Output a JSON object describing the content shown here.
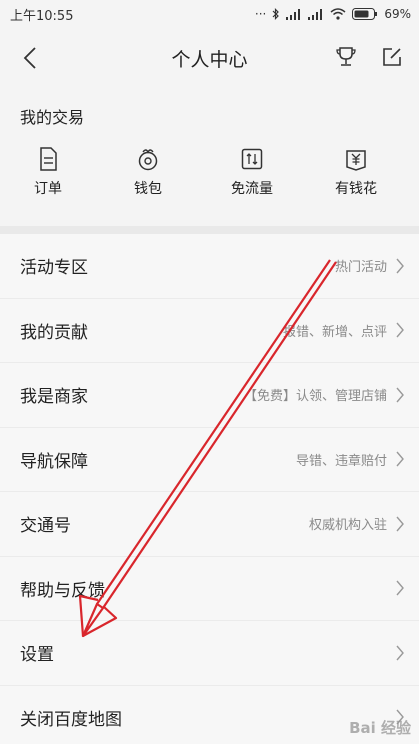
{
  "status": {
    "time": "上午10:55",
    "dots": "···",
    "battery_text": "69%"
  },
  "header": {
    "title": "个人中心"
  },
  "trade": {
    "title": "我的交易",
    "items": [
      {
        "label": "订单",
        "icon": "order-icon"
      },
      {
        "label": "钱包",
        "icon": "wallet-icon"
      },
      {
        "label": "免流量",
        "icon": "free-data-icon"
      },
      {
        "label": "有钱花",
        "icon": "loan-icon"
      }
    ]
  },
  "menu": [
    {
      "label": "活动专区",
      "sub": "热门活动"
    },
    {
      "label": "我的贡献",
      "sub": "报错、新增、点评"
    },
    {
      "label": "我是商家",
      "sub": "【免费】认领、管理店铺"
    },
    {
      "label": "导航保障",
      "sub": "导错、违章赔付"
    },
    {
      "label": "交通号",
      "sub": "权威机构入驻"
    },
    {
      "label": "帮助与反馈",
      "sub": ""
    },
    {
      "label": "设置",
      "sub": ""
    },
    {
      "label": "关闭百度地图",
      "sub": ""
    }
  ],
  "watermark": "Bai 经验",
  "colors": {
    "annotation_arrow": "#d9262c",
    "background": "#f4f4f4",
    "subtext": "#8a8a8a"
  }
}
